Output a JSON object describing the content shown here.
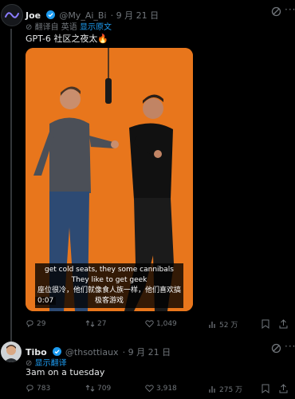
{
  "tweet1": {
    "name": "Joe",
    "handle": "@My_Ai_Bi",
    "date": "· 9 月 21 日",
    "translated_note": "翻译自 英语",
    "show_original": "显示原文",
    "text": "GPT-6 社区之夜太🔥",
    "video": {
      "caption_en": "get cold seats, they some cannibals They like to get geek",
      "caption_zh": "座位很冷，他们就像食人族一样，他们喜欢搞极客游戏",
      "time": "0:07"
    },
    "stats": {
      "replies": "29",
      "retweets": "27",
      "likes": "1,049",
      "views": "52 万"
    }
  },
  "tweet2": {
    "name": "Tibo",
    "handle": "@thsottiaux",
    "date": "· 9 月 21 日",
    "show_translation": "显示翻译",
    "text": "3am on a tuesday",
    "stats": {
      "replies": "783",
      "retweets": "709",
      "likes": "3,918",
      "views": "275 万"
    }
  }
}
